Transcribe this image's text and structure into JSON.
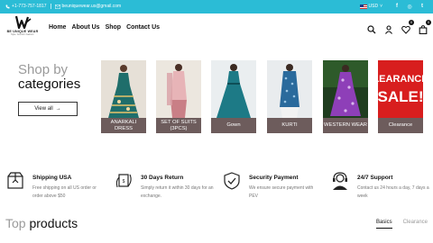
{
  "topbar": {
    "phone": "+1-773-757-1817",
    "email": "beuniquewear.us@gmail.com",
    "currency": "USD",
    "currency_caret": "˅",
    "social": [
      "facebook-icon",
      "instagram-icon",
      "twitter-icon"
    ],
    "social_glyphs": [
      "f",
      "◎",
      "t"
    ],
    "bg_color": "#2bbcd6"
  },
  "header": {
    "logo_title": "BE UNIQUE WEAR",
    "logo_tagline": "Style. Comfort. Fashion.",
    "nav": [
      "Home",
      "About Us",
      "Shop",
      "Contact Us"
    ],
    "wishlist_count": "0",
    "cart_count": "0"
  },
  "shop_by": {
    "line1": "Shop by",
    "line2": "categories",
    "view_all": "View all",
    "view_all_arrow": "→"
  },
  "categories": [
    {
      "label": "ANARKALI DRESS"
    },
    {
      "label": "SET OF SUITS (3PCS)"
    },
    {
      "label": "Gown"
    },
    {
      "label": "KURTI"
    },
    {
      "label": "WESTERN WEAR"
    },
    {
      "label": "Clearance",
      "banner_line1": "LEARANCE",
      "banner_line2": "SALE!"
    }
  ],
  "features": [
    {
      "title": "Shipping USA",
      "desc": "Free shipping on all US order or order above $50",
      "icon": "box-icon"
    },
    {
      "title": "30 Days Return",
      "desc": "Simply return it within 30 days for an exchange.",
      "icon": "return-icon"
    },
    {
      "title": "Security Payment",
      "desc": "We ensure secure payment with PEV",
      "icon": "shield-icon"
    },
    {
      "title": "24/7 Support",
      "desc": "Contact us 24 hours a day, 7 days a week",
      "icon": "headset-icon"
    }
  ],
  "top_products": {
    "word1": "Top",
    "word2": " products",
    "tabs": [
      "Basics",
      "Clearance"
    ]
  }
}
